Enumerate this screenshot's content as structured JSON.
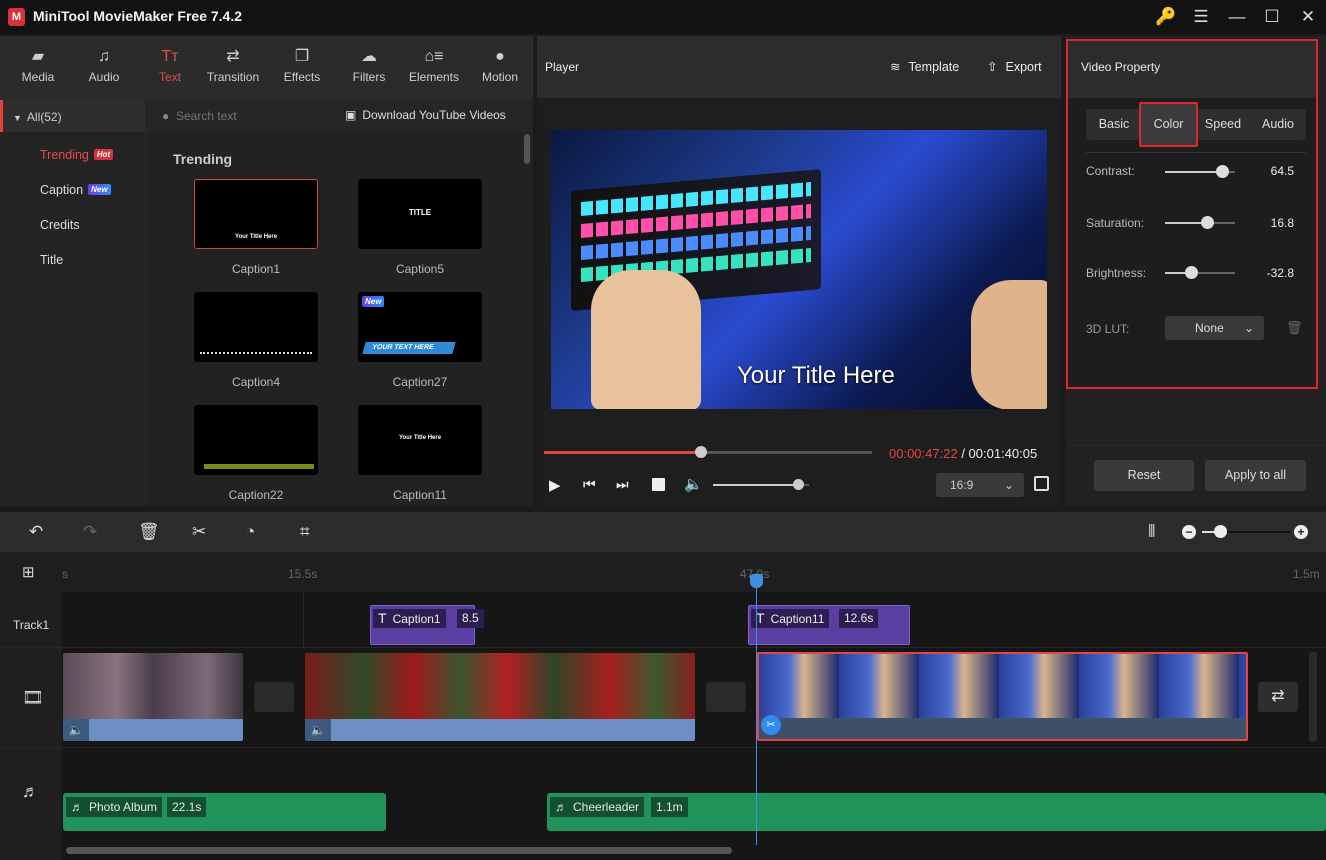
{
  "app": {
    "title": "MiniTool MovieMaker Free 7.4.2",
    "logo": "M"
  },
  "window_controls": {
    "key": "🔑",
    "menu": "☰",
    "minimize": "—",
    "maximize": "☐",
    "close": "✕"
  },
  "nav": [
    {
      "label": "Media",
      "icon": "▰"
    },
    {
      "label": "Audio",
      "icon": "♫"
    },
    {
      "label": "Text",
      "icon": "Tт"
    },
    {
      "label": "Transition",
      "icon": "⇄"
    },
    {
      "label": "Effects",
      "icon": "❐"
    },
    {
      "label": "Filters",
      "icon": "☁"
    },
    {
      "label": "Elements",
      "icon": "⌂≡"
    },
    {
      "label": "Motion",
      "icon": "●"
    }
  ],
  "library": {
    "category_all": "All(52)",
    "search_placeholder": "Search text",
    "download_label": "Download YouTube Videos",
    "categories": [
      {
        "label": "Trending",
        "badge": "Hot"
      },
      {
        "label": "Caption",
        "badge": "New"
      },
      {
        "label": "Credits"
      },
      {
        "label": "Title"
      }
    ],
    "section_title": "Trending",
    "thumbnails": [
      {
        "label": "Caption1",
        "preview_text": "Your Title Here"
      },
      {
        "label": "Caption5",
        "preview_text": "TITLE"
      },
      {
        "label": "Caption4",
        "preview_text": ""
      },
      {
        "label": "Caption27",
        "preview_text": "YOUR TEXT HERE",
        "badge": "New"
      },
      {
        "label": "Caption22",
        "preview_text": ""
      },
      {
        "label": "Caption11",
        "preview_text": "Your Title Here"
      }
    ]
  },
  "player": {
    "title": "Player",
    "template_label": "Template",
    "export_label": "Export",
    "overlay_text": "Your Title Here",
    "current_time": "00:00:47:22",
    "total_time": "/ 00:01:40:05",
    "progress": 0.48,
    "volume": 0.9,
    "aspect_ratio": "16:9"
  },
  "properties": {
    "title": "Video Property",
    "tabs": [
      "Basic",
      "Color",
      "Speed",
      "Audio"
    ],
    "active_tab": "Color",
    "contrast": {
      "label": "Contrast:",
      "value": "64.5",
      "fraction": 0.82
    },
    "saturation": {
      "label": "Saturation:",
      "value": "16.8",
      "fraction": 0.6
    },
    "brightness": {
      "label": "Brightness:",
      "value": "-32.8",
      "fraction": 0.37
    },
    "lut": {
      "label": "3D LUT:",
      "value": "None"
    },
    "reset_label": "Reset",
    "apply_label": "Apply to all"
  },
  "timeline": {
    "ruler": [
      "s",
      "15.5s",
      "47.9s",
      "1.5m"
    ],
    "track1_label": "Track1",
    "zoom_level": 0.2,
    "captions": [
      {
        "label": "Caption1",
        "duration": "8.5"
      },
      {
        "label": "Caption11",
        "duration": "12.6s"
      }
    ],
    "audio": [
      {
        "label": "Photo Album",
        "duration": "22.1s"
      },
      {
        "label": "Cheerleader",
        "duration": "1.1m"
      }
    ]
  }
}
